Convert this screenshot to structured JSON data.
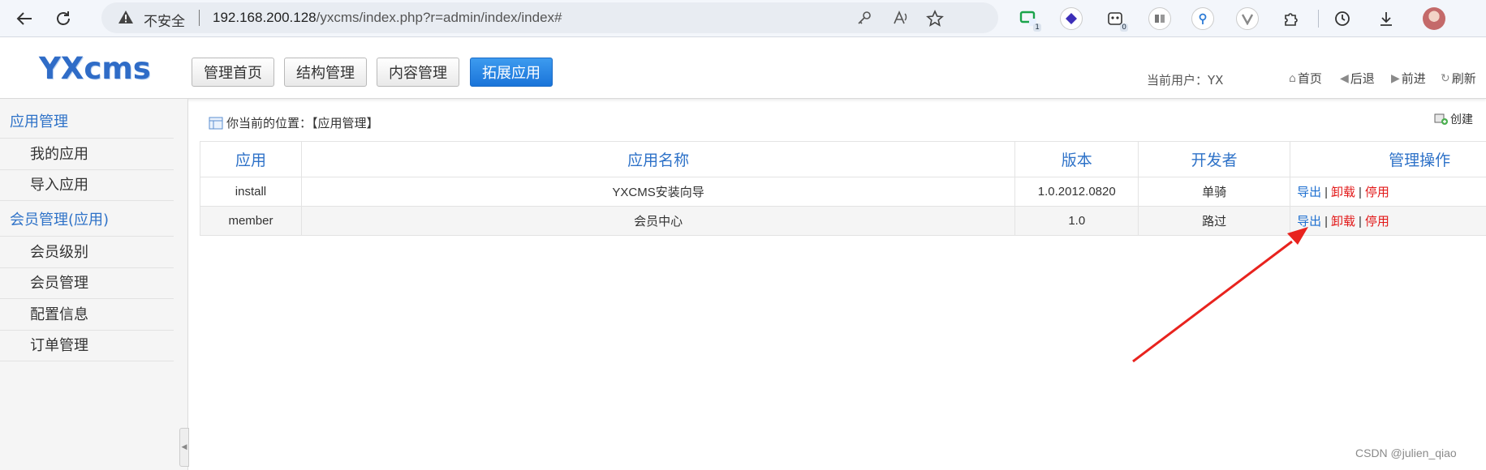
{
  "browser": {
    "insecure_label": "不安全",
    "url_host": "192.168.200.128",
    "url_path": "/yxcms/index.php?r=admin/index/index#",
    "ext_badge_1": "1",
    "ext_badge_2": "0"
  },
  "header": {
    "logo": "YXcms",
    "menu": [
      "管理首页",
      "结构管理",
      "内容管理",
      "拓展应用"
    ],
    "current_user": "当前用户：YX",
    "nav": {
      "home": "首页",
      "back": "后退",
      "forward": "前进",
      "refresh": "刷新"
    }
  },
  "sidebar": {
    "group1": "应用管理",
    "group1_items": [
      "我的应用",
      "导入应用"
    ],
    "group2": "会员管理(应用)",
    "group2_items": [
      "会员级别",
      "会员管理",
      "配置信息",
      "订单管理"
    ]
  },
  "main": {
    "breadcrumb": "你当前的位置：【应用管理】",
    "create": "创建",
    "columns": [
      "应用",
      "应用名称",
      "版本",
      "开发者",
      "管理操作"
    ],
    "rows": [
      {
        "app": "install",
        "name": "YXCMS安装向导",
        "version": "1.0.2012.0820",
        "dev": "单骑",
        "op_export": "导出",
        "op_uninstall": "卸载",
        "op_disable": "停用"
      },
      {
        "app": "member",
        "name": "会员中心",
        "version": "1.0",
        "dev": "路过",
        "op_export": "导出",
        "op_uninstall": "卸载",
        "op_disable": "停用"
      }
    ],
    "op_sep": "|"
  },
  "watermark": "CSDN @julien_qiao",
  "colors": {
    "accent": "#2e72c8",
    "active_button": "#1a74d9",
    "danger_link": "#e21818",
    "arrow": "#e8231e"
  }
}
